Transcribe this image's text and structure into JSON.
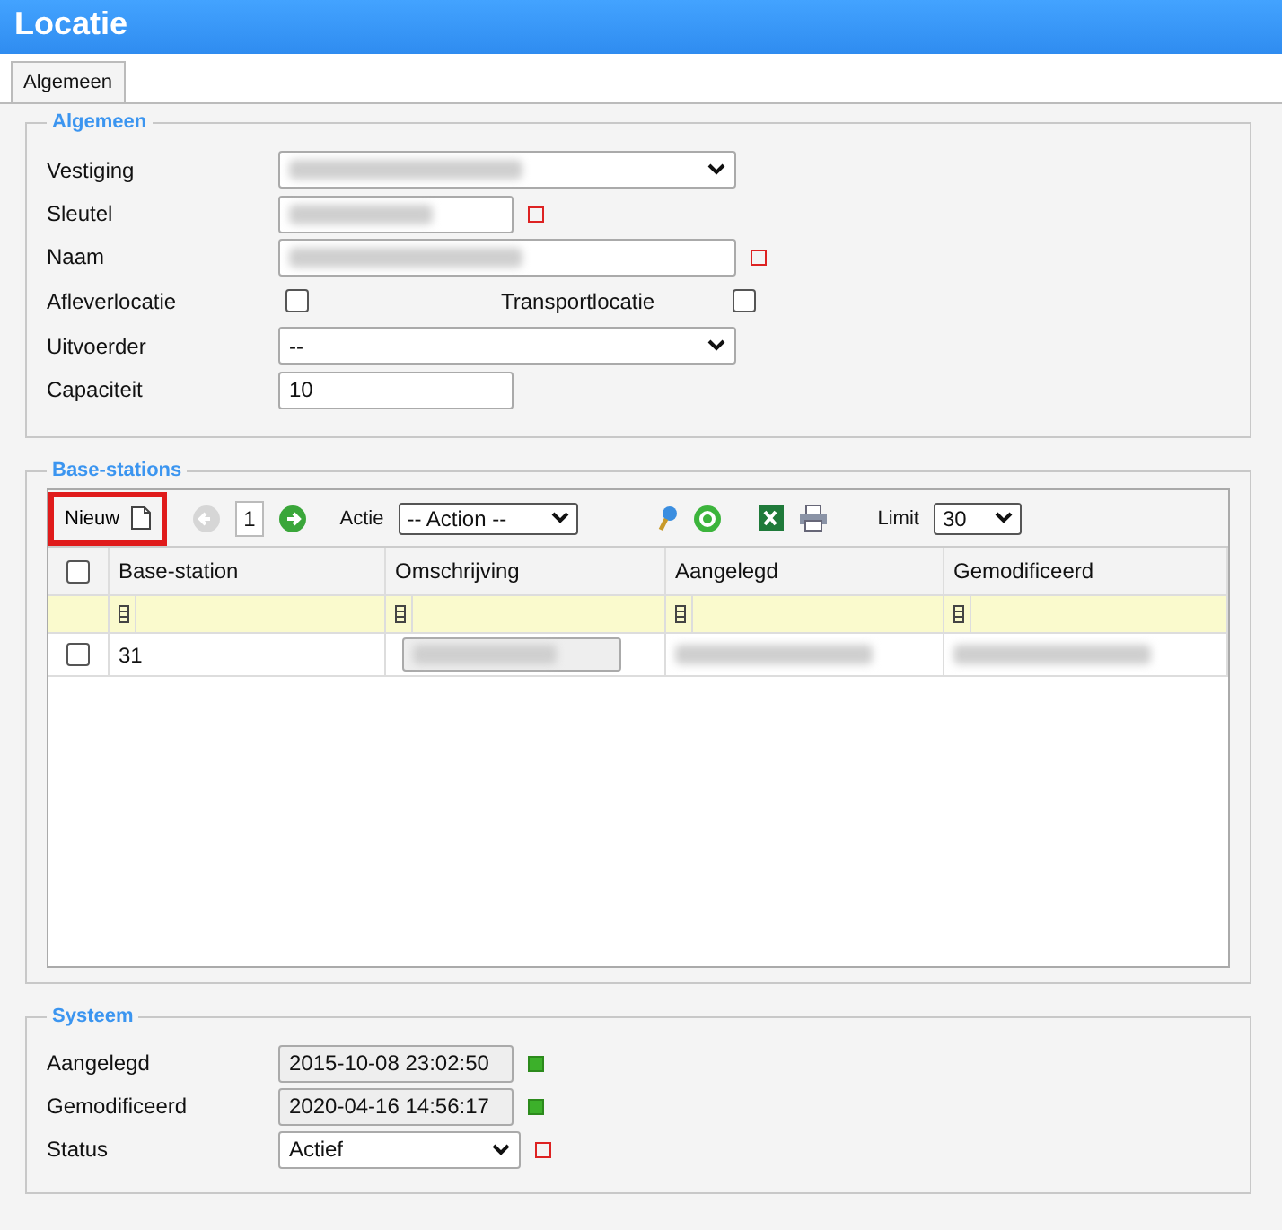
{
  "window": {
    "title": "Locatie"
  },
  "tabs": [
    {
      "label": "Algemeen",
      "selected": true
    }
  ],
  "algemeen": {
    "legend": "Algemeen",
    "rows": [
      {
        "kind": "select",
        "label": "Vestiging",
        "redacted": true,
        "required": false
      },
      {
        "kind": "short_input",
        "label": "Sleutel",
        "redacted": true,
        "required": true
      },
      {
        "kind": "long_input",
        "label": "Naam",
        "redacted": true,
        "required": true
      },
      {
        "kind": "checkboxes",
        "items": [
          {
            "label": "Afleverlocatie",
            "checked": false
          },
          {
            "label": "Transportlocatie",
            "checked": false
          }
        ]
      },
      {
        "kind": "select",
        "label": "Uitvoerder",
        "value": "--",
        "redacted": false,
        "required": false
      },
      {
        "kind": "short_input",
        "label": "Capaciteit",
        "value": "10",
        "redacted": false,
        "required": false
      }
    ]
  },
  "base_stations": {
    "legend": "Base-stations",
    "toolbar": {
      "new_label": "Nieuw",
      "page": "1",
      "action_label": "Actie",
      "action_value": "-- Action --",
      "limit_label": "Limit",
      "limit_value": "30"
    },
    "select_all_checked": false,
    "columns": [
      "Base-station",
      "Omschrijving",
      "Aangelegd",
      "Gemodificeerd"
    ],
    "rows": [
      {
        "checked": false,
        "base_station": "31"
      }
    ]
  },
  "systeem": {
    "legend": "Systeem",
    "rows": [
      {
        "kind": "readonly",
        "label": "Aangelegd",
        "value": "2015-10-08 23:02:50",
        "valid": true,
        "required": false
      },
      {
        "kind": "readonly",
        "label": "Gemodificeerd",
        "value": "2020-04-16 14:56:17",
        "valid": true,
        "required": false
      },
      {
        "kind": "status_select",
        "label": "Status",
        "value": "Actief",
        "valid": false,
        "required": true
      }
    ]
  }
}
